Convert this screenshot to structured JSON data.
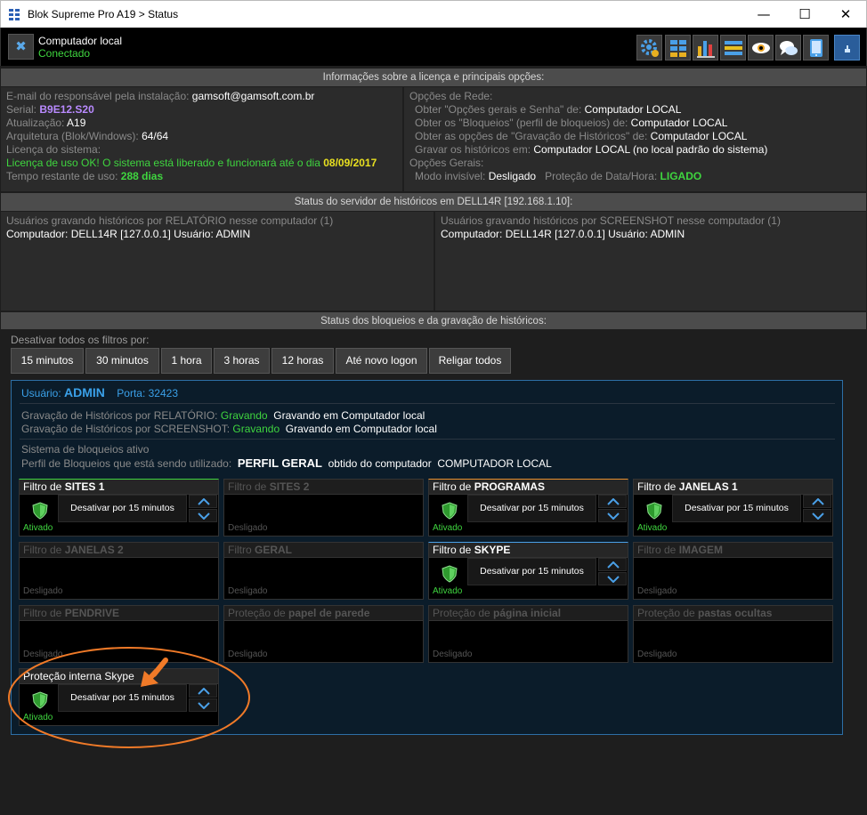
{
  "window": {
    "title": "Blok Supreme Pro A19 > Status",
    "minimize": "—",
    "maximize": "☐",
    "close": "✕"
  },
  "topbar": {
    "close_glyph": "✖",
    "computer": "Computador local",
    "status": "Conectado",
    "tools": [
      "gear-icon",
      "grid-icon",
      "bar-chart-icon",
      "list-icon",
      "eye-icon",
      "chat-icon",
      "tablet-icon",
      "info-icon"
    ]
  },
  "section1": {
    "header": "Informações sobre a licença e principais opções:",
    "left": {
      "email_label": "E-mail do responsável pela instalação:",
      "email": "gamsoft@gamsoft.com.br",
      "serial_label": "Serial:",
      "serial": "B9E12.S20",
      "update_label": "Atualização:",
      "update": "A19",
      "arch_label": "Arquitetura (Blok/Windows):",
      "arch": "64/64",
      "license_label": "Licença do sistema:",
      "license_text": "Licença de uso OK! O sistema está liberado e funcionará até o dia",
      "license_date": "08/09/2017",
      "time_label": "Tempo restante de uso:",
      "time": "288 dias"
    },
    "right": {
      "net_label": "Opções de Rede:",
      "r1_label": "Obter \"Opções gerais e Senha\" de:",
      "r1_val": "Computador LOCAL",
      "r2_label": "Obter os \"Bloqueios\" (perfil de bloqueios) de:",
      "r2_val": "Computador LOCAL",
      "r3_label": "Obter as opções de \"Gravação de Históricos\" de:",
      "r3_val": "Computador LOCAL",
      "r4_label": "Gravar os históricos em:",
      "r4_val": "Computador LOCAL (no local padrão do sistema)",
      "gen_label": "Opções Gerais:",
      "inv_label": "Modo invisível:",
      "inv_val": "Desligado",
      "dt_label": "Proteção de Data/Hora:",
      "dt_val": "LIGADO"
    }
  },
  "section2": {
    "header": "Status do servidor de históricos em DELL14R [192.168.1.10]:",
    "left_title": "Usuários gravando históricos por RELATÓRIO nesse computador (1)",
    "left_line": "Computador: DELL14R [127.0.0.1] Usuário: ADMIN",
    "right_title": "Usuários gravando históricos por SCREENSHOT nesse computador (1)",
    "right_line": "Computador: DELL14R [127.0.0.1] Usuário: ADMIN"
  },
  "section3": {
    "header": "Status dos bloqueios e da gravação de históricos:",
    "disable_label": "Desativar todos os filtros por:",
    "buttons": [
      "15 minutos",
      "30 minutos",
      "1 hora",
      "3 horas",
      "12 horas",
      "Até novo logon",
      "Religar todos"
    ],
    "user_label": "Usuário:",
    "user": "ADMIN",
    "port_label": "Porta:",
    "port": "32423",
    "rel_label": "Gravação de Históricos por RELATÓRIO:",
    "rel_status": "Gravando",
    "rel_where": "Gravando em Computador local",
    "scr_label": "Gravação de Históricos por SCREENSHOT:",
    "scr_status": "Gravando",
    "scr_where": "Gravando em Computador local",
    "block_active": "Sistema de bloqueios ativo",
    "profile_label": "Perfil de Bloqueios que está sendo utilizado:",
    "profile": "PERFIL GERAL",
    "profile_from": "obtido do computador",
    "profile_comp": "COMPUTADOR LOCAL",
    "tiles": [
      {
        "pre": "Filtro de ",
        "name": "SITES 1",
        "active": true,
        "status": "Ativado",
        "btn": "Desativar por 15 minutos"
      },
      {
        "pre": "Filtro de ",
        "name": "SITES 2",
        "active": false,
        "status": "Desligado"
      },
      {
        "pre": "Filtro de ",
        "name": "PROGRAMAS",
        "active": true,
        "status": "Ativado",
        "btn": "Desativar por 15 minutos"
      },
      {
        "pre": "Filtro de ",
        "name": "JANELAS 1",
        "active": true,
        "status": "Ativado",
        "btn": "Desativar por 15 minutos"
      },
      {
        "pre": "Filtro de ",
        "name": "JANELAS 2",
        "active": false,
        "status": "Desligado"
      },
      {
        "pre": "Filtro ",
        "name": "GERAL",
        "active": false,
        "status": "Desligado"
      },
      {
        "pre": "Filtro de ",
        "name": "SKYPE",
        "active": true,
        "status": "Ativado",
        "btn": "Desativar por 15 minutos"
      },
      {
        "pre": "Filtro de ",
        "name": "IMAGEM",
        "active": false,
        "status": "Desligado"
      },
      {
        "pre": "Filtro de ",
        "name": "PENDRIVE",
        "active": false,
        "status": "Desligado"
      },
      {
        "pre": "Proteção de ",
        "name": "papel de parede",
        "active": false,
        "status": "Desligado"
      },
      {
        "pre": "Proteção de ",
        "name": "página inicial",
        "active": false,
        "status": "Desligado"
      },
      {
        "pre": "Proteção de ",
        "name": "pastas ocultas",
        "active": false,
        "status": "Desligado"
      },
      {
        "pre": "Proteção interna Skype",
        "name": "",
        "active": true,
        "status": "Ativado",
        "btn": "Desativar por 15 minutos"
      }
    ]
  },
  "colors": {
    "accent": "#3aa0e8",
    "active": "#3fd53f",
    "annotation": "#f07a28"
  }
}
